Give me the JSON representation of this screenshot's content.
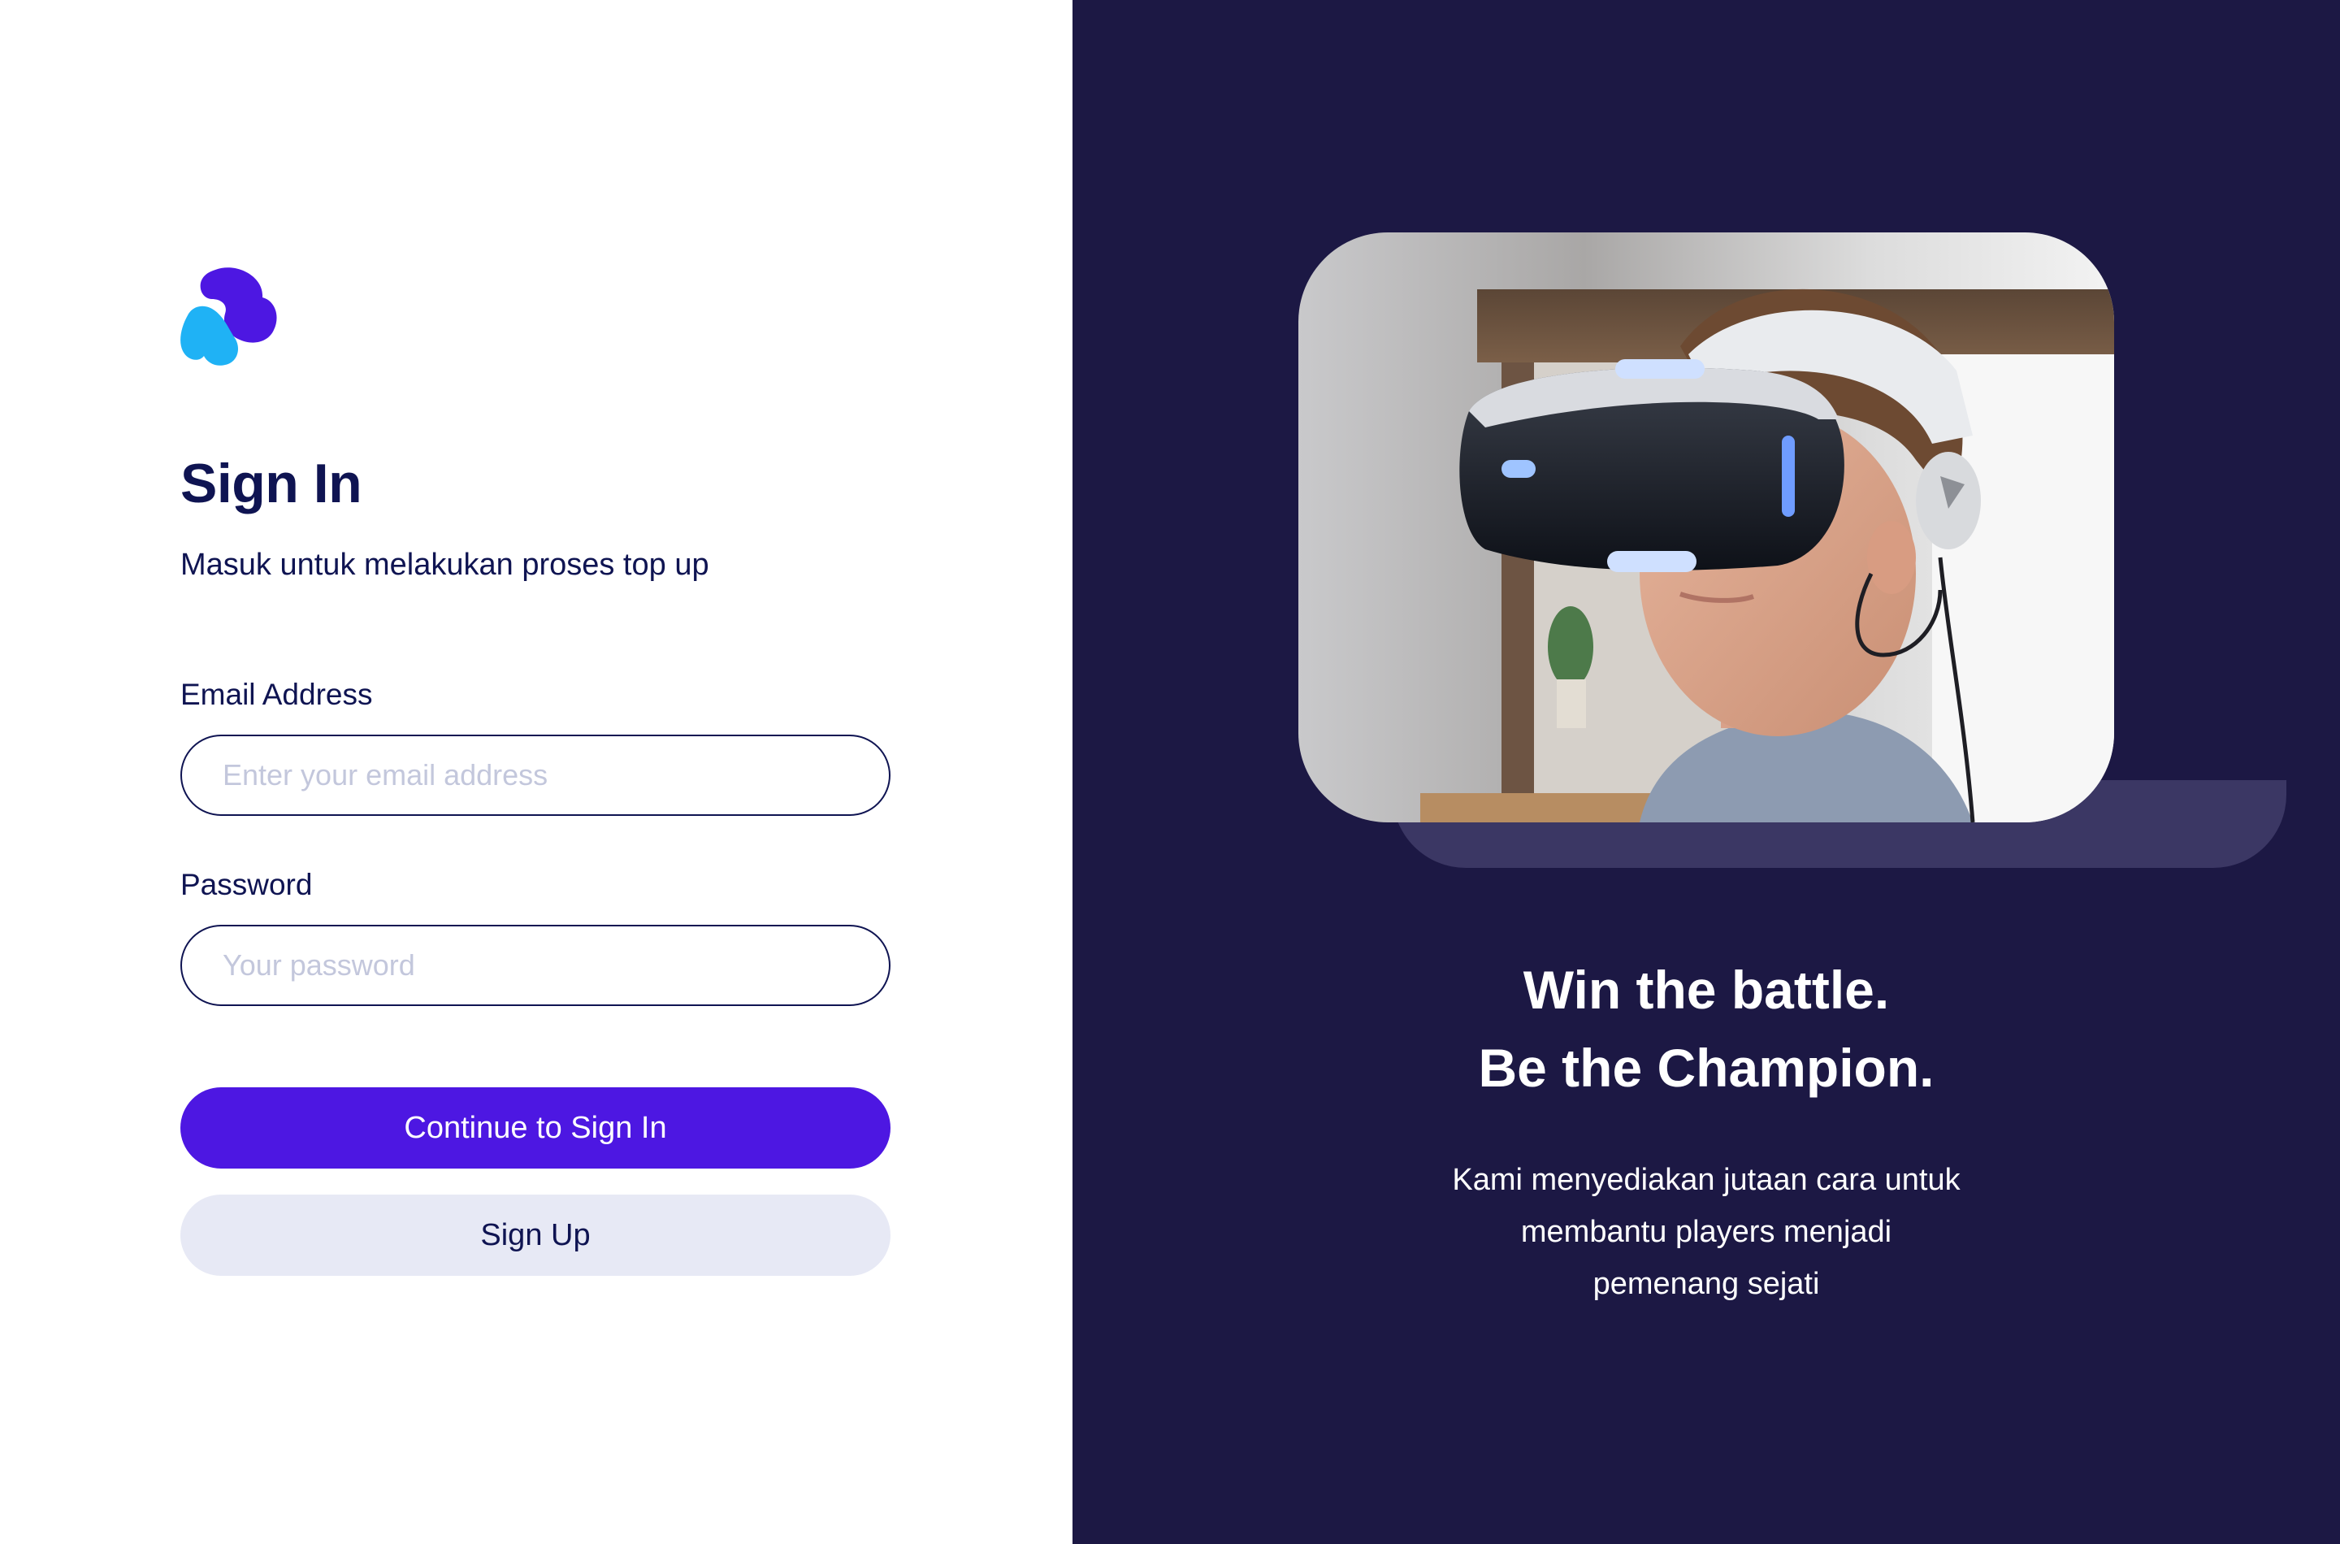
{
  "signin": {
    "title": "Sign In",
    "subtitle": "Masuk untuk melakukan proses top up",
    "email_label": "Email Address",
    "email_placeholder": "Enter your email address",
    "password_label": "Password",
    "password_placeholder": "Your password",
    "continue_label": "Continue to Sign In",
    "signup_label": "Sign Up"
  },
  "hero": {
    "headline_line1": "Win the battle.",
    "headline_line2": "Be the Champion.",
    "desc_line1": "Kami menyediakan jutaan cara untuk",
    "desc_line2": "membantu players menjadi",
    "desc_line3": "pemenang sejati",
    "image_icon": "vr-headset-photo"
  },
  "colors": {
    "primary": "#4d17e2",
    "navy": "#0f1452",
    "dark_bg": "#1c1844",
    "secondary_button": "#e7e9f5",
    "logo_blue": "#1fb2f5",
    "logo_purple": "#4d17e2"
  }
}
